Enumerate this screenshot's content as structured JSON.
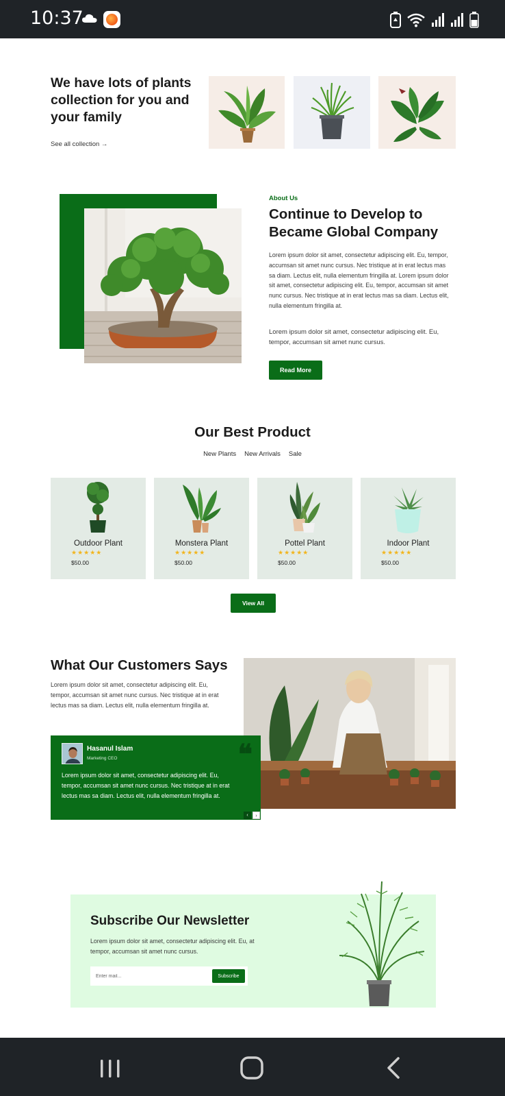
{
  "status_bar": {
    "time": "10:37",
    "icons": [
      "cloud-icon",
      "app-notification-icon",
      "battery-saver-icon",
      "wifi-icon",
      "signal-icon",
      "signal-icon",
      "battery-icon"
    ]
  },
  "collection": {
    "title": "We have lots of plants collection for you and your family",
    "link": "See all collection →",
    "thumb_colors": [
      "#f6ede7",
      "#eef0f5",
      "#f6ede7"
    ]
  },
  "about": {
    "kicker": "About Us",
    "title": "Continue to Develop to Became Global Company",
    "paragraph_1": "Lorem ipsum dolor sit amet, consectetur adipiscing elit. Eu, tempor, accumsan sit amet nunc cursus. Nec tristique at in erat lectus mas sa diam. Lectus elit, nulla elementum fringilla at. Lorem ipsum dolor sit amet, consectetur adipiscing elit. Eu, tempor, accumsan sit amet nunc cursus. Nec tristique at in erat lectus mas sa diam. Lectus elit, nulla elementum fringilla at.",
    "paragraph_2": "Lorem ipsum dolor sit amet, consectetur adipiscing elit. Eu, tempor, accumsan sit amet nunc cursus.",
    "button": "Read More"
  },
  "products": {
    "title": "Our Best Product",
    "tabs": [
      "New Plants",
      "New Arrivals",
      "Sale"
    ],
    "items": [
      {
        "name": "Outdoor Plant",
        "stars": "★★★★★",
        "rating": 5,
        "price": "$50.00"
      },
      {
        "name": "Monstera Plant",
        "stars": "★★★★★",
        "rating": 5,
        "price": "$50.00"
      },
      {
        "name": "Pottel Plant",
        "stars": "★★★★★",
        "rating": 5,
        "price": "$50.00"
      },
      {
        "name": "Indoor Plant",
        "stars": "★★★★★",
        "rating": 5,
        "price": "$50.00"
      }
    ],
    "view_all": "View All"
  },
  "testimonials": {
    "title": "What Our Customers Says",
    "paragraph": "Lorem ipsum dolor sit amet, consectetur adipiscing elit. Eu, tempor, accumsan sit amet nunc cursus. Nec tristique at in erat lectus mas sa diam. Lectus elit, nulla elementum fringilla at.",
    "card": {
      "name": "Hasanul Islam",
      "role": "Marketing CEO",
      "quote_mark": "❝",
      "text": "Lorem ipsum dolor sit amet, consectetur adipiscing elit. Eu, tempor, accumsan sit amet nunc cursus. Nec tristique at in erat lectus mas sa diam. Lectus elit, nulla elementum fringilla at."
    },
    "prev": "‹",
    "next": "›"
  },
  "newsletter": {
    "title": "Subscribe Our Newsletter",
    "paragraph": "Lorem ipsum dolor sit amet, consectetur adipiscing elit. Eu, at tempor, accumsan sit amet nunc cursus.",
    "placeholder": "Enter mail...",
    "button": "Subscribe"
  },
  "colors": {
    "brand_green": "#0a6d18",
    "card_bg": "#e3ebe5",
    "newsletter_bg": "#dffbe1",
    "star": "#f2b51d"
  },
  "nav_bar": {
    "icons": [
      "recent-apps-icon",
      "home-icon",
      "back-icon"
    ]
  }
}
